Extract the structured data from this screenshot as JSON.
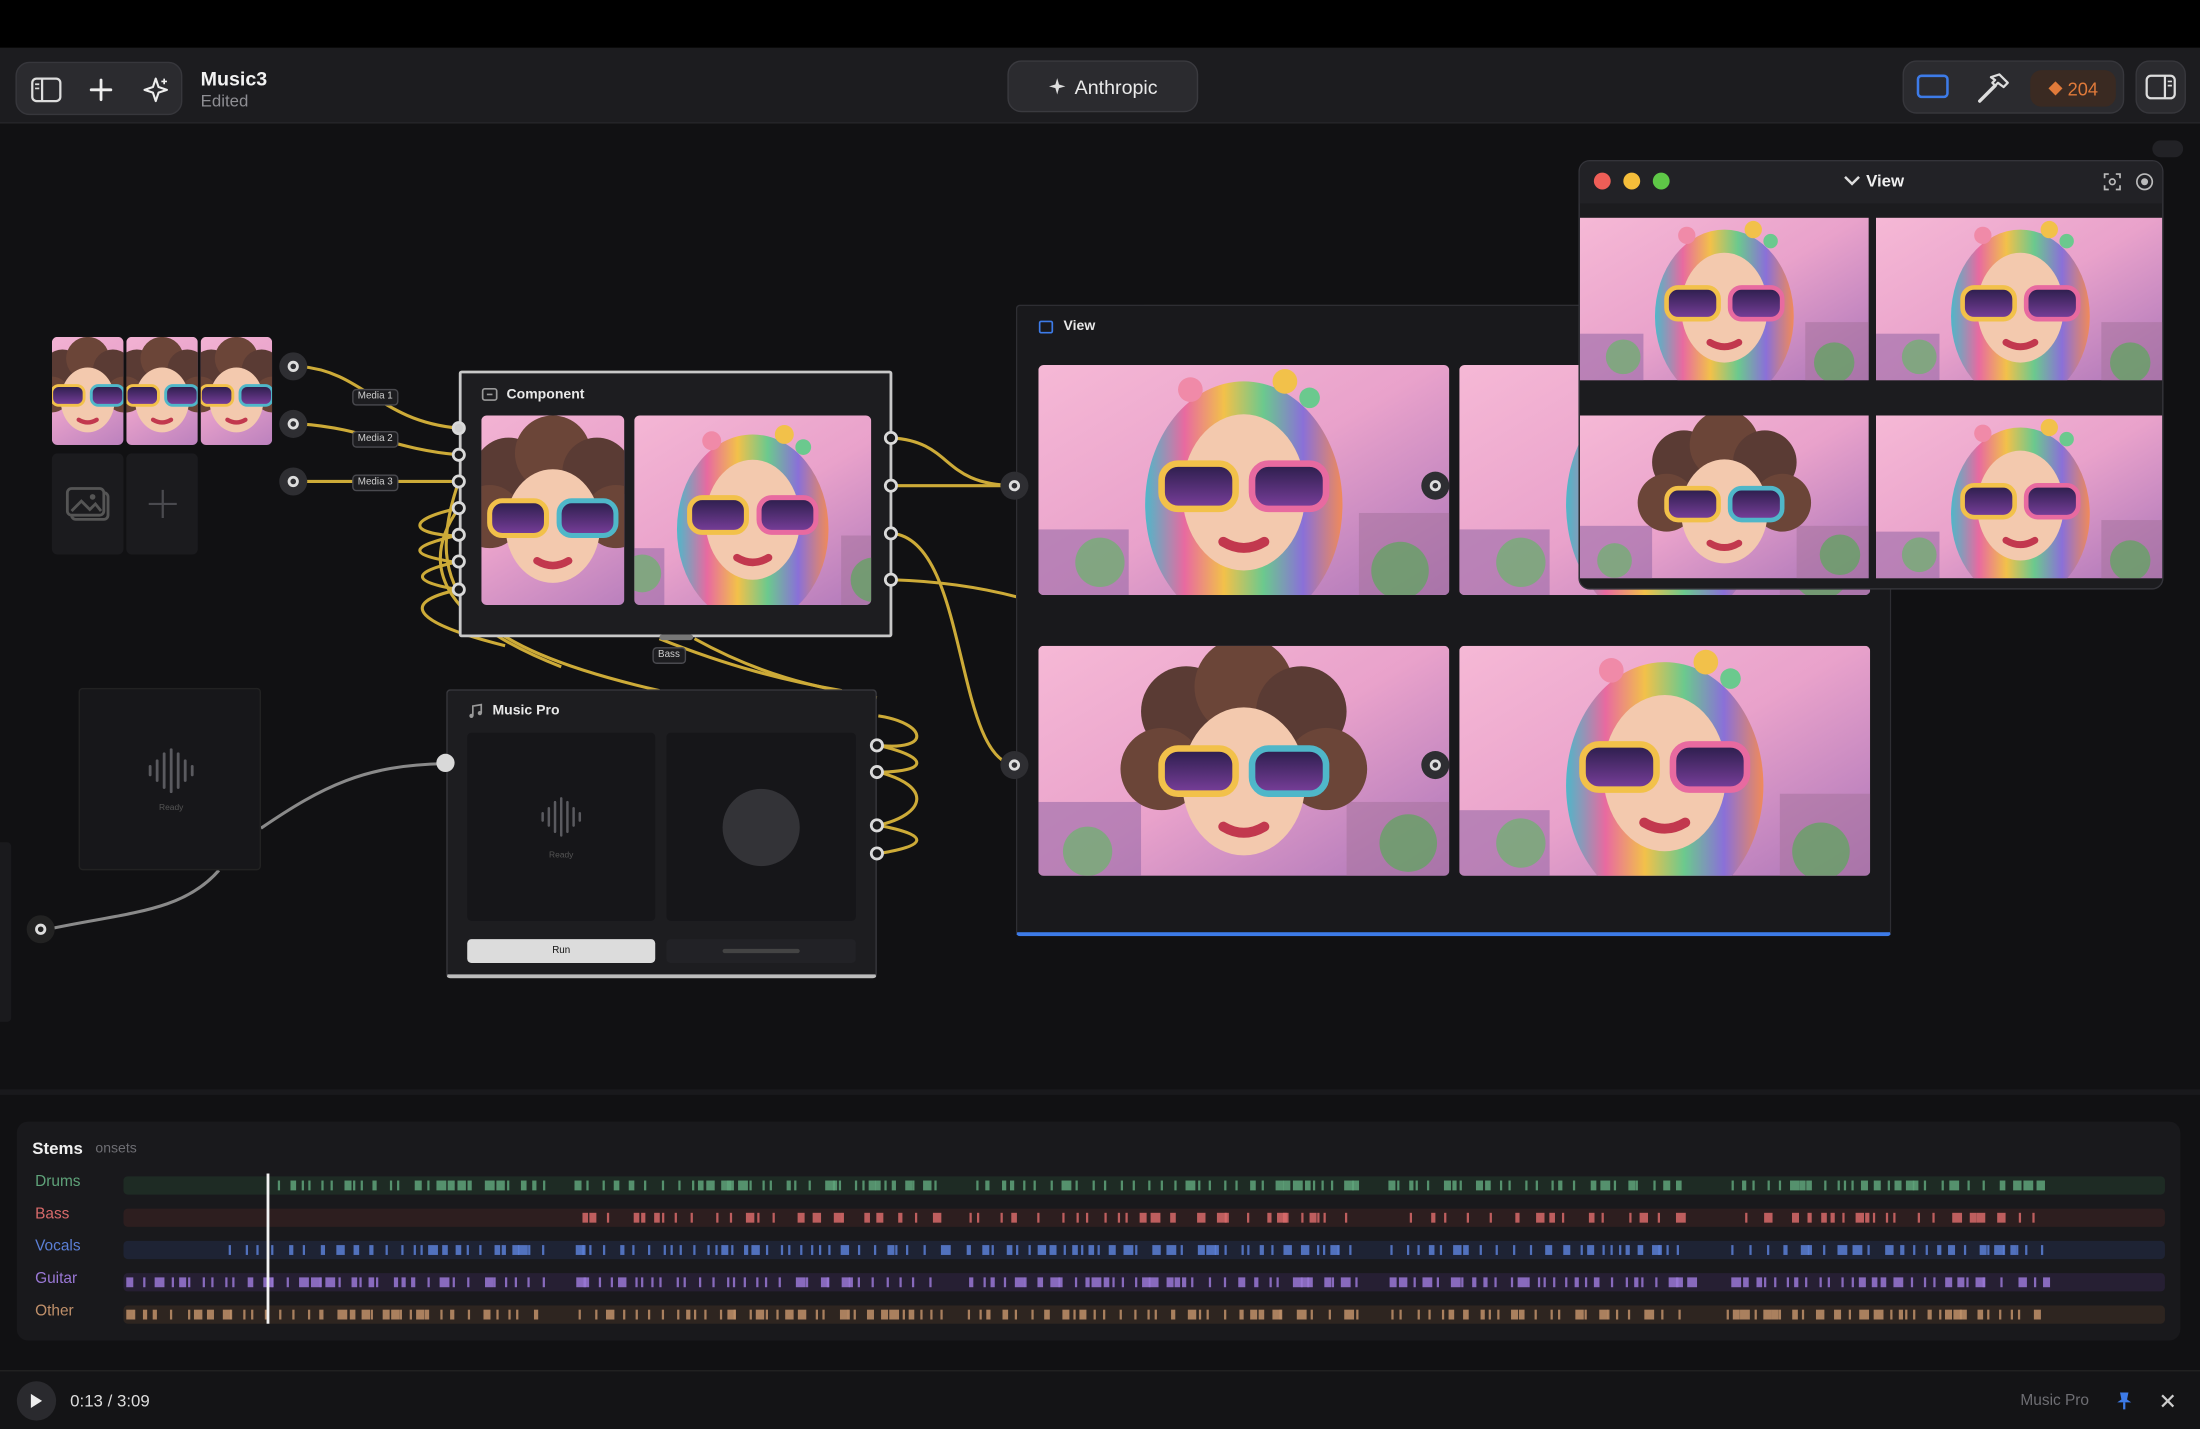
{
  "toolbar": {
    "project_title": "Music3",
    "project_status": "Edited",
    "center_label": "Anthropic",
    "badge_count": "204",
    "icons": [
      "sidebar-left-icon",
      "plus-icon",
      "sparkle-icon",
      "window-icon",
      "hammer-icon",
      "diamond-icon",
      "sidebar-right-icon"
    ]
  },
  "canvas": {
    "media_tags": [
      "Media 1",
      "Media 2",
      "Media 3"
    ],
    "bass_tag": "Bass",
    "component_node": {
      "title": "Component"
    },
    "music_pro_node": {
      "title": "Music Pro",
      "status": "Ready",
      "run_label": "Run"
    },
    "audio_placeholder": {
      "status": "Ready"
    },
    "view_node": {
      "title": "View"
    },
    "floating_view": {
      "title": "View"
    }
  },
  "stems": {
    "title": "Stems",
    "subtitle": "onsets",
    "playhead_time": 13,
    "duration": 189,
    "lanes": [
      {
        "label": "Drums",
        "color": "#5fa37a",
        "bg": "#1e2b24"
      },
      {
        "label": "Bass",
        "color": "#d86a6a",
        "bg": "#2d1e1f"
      },
      {
        "label": "Vocals",
        "color": "#5b7fd6",
        "bg": "#1e2334"
      },
      {
        "label": "Guitar",
        "color": "#9a78d6",
        "bg": "#261f33"
      },
      {
        "label": "Other",
        "color": "#c0906a",
        "bg": "#2e2520"
      }
    ]
  },
  "transport": {
    "time_label": "0:13 / 3:09",
    "source_label": "Music Pro"
  },
  "colors": {
    "wire": "#d8b43a",
    "accent": "#3d7be8",
    "grey_wire": "#8a8a8a"
  }
}
